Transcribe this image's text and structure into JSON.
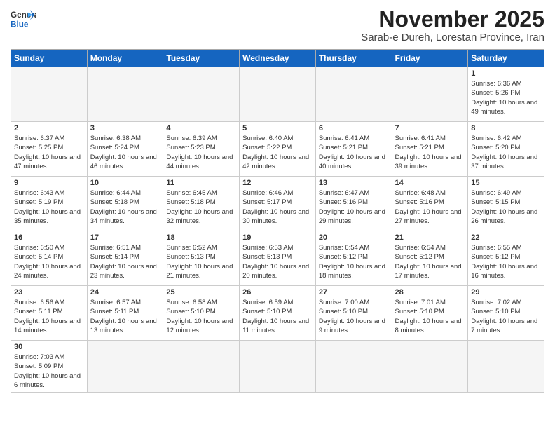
{
  "logo": {
    "general": "General",
    "blue": "Blue"
  },
  "header": {
    "month": "November 2025",
    "location": "Sarab-e Dureh, Lorestan Province, Iran"
  },
  "weekdays": [
    "Sunday",
    "Monday",
    "Tuesday",
    "Wednesday",
    "Thursday",
    "Friday",
    "Saturday"
  ],
  "weeks": [
    [
      {
        "day": "",
        "empty": true
      },
      {
        "day": "",
        "empty": true
      },
      {
        "day": "",
        "empty": true
      },
      {
        "day": "",
        "empty": true
      },
      {
        "day": "",
        "empty": true
      },
      {
        "day": "",
        "empty": true
      },
      {
        "day": "1",
        "sunrise": "6:36 AM",
        "sunset": "5:26 PM",
        "daylight": "10 hours and 49 minutes."
      }
    ],
    [
      {
        "day": "2",
        "sunrise": "6:37 AM",
        "sunset": "5:25 PM",
        "daylight": "10 hours and 47 minutes."
      },
      {
        "day": "3",
        "sunrise": "6:38 AM",
        "sunset": "5:24 PM",
        "daylight": "10 hours and 46 minutes."
      },
      {
        "day": "4",
        "sunrise": "6:39 AM",
        "sunset": "5:23 PM",
        "daylight": "10 hours and 44 minutes."
      },
      {
        "day": "5",
        "sunrise": "6:40 AM",
        "sunset": "5:22 PM",
        "daylight": "10 hours and 42 minutes."
      },
      {
        "day": "6",
        "sunrise": "6:41 AM",
        "sunset": "5:21 PM",
        "daylight": "10 hours and 40 minutes."
      },
      {
        "day": "7",
        "sunrise": "6:41 AM",
        "sunset": "5:21 PM",
        "daylight": "10 hours and 39 minutes."
      },
      {
        "day": "8",
        "sunrise": "6:42 AM",
        "sunset": "5:20 PM",
        "daylight": "10 hours and 37 minutes."
      }
    ],
    [
      {
        "day": "9",
        "sunrise": "6:43 AM",
        "sunset": "5:19 PM",
        "daylight": "10 hours and 35 minutes."
      },
      {
        "day": "10",
        "sunrise": "6:44 AM",
        "sunset": "5:18 PM",
        "daylight": "10 hours and 34 minutes."
      },
      {
        "day": "11",
        "sunrise": "6:45 AM",
        "sunset": "5:18 PM",
        "daylight": "10 hours and 32 minutes."
      },
      {
        "day": "12",
        "sunrise": "6:46 AM",
        "sunset": "5:17 PM",
        "daylight": "10 hours and 30 minutes."
      },
      {
        "day": "13",
        "sunrise": "6:47 AM",
        "sunset": "5:16 PM",
        "daylight": "10 hours and 29 minutes."
      },
      {
        "day": "14",
        "sunrise": "6:48 AM",
        "sunset": "5:16 PM",
        "daylight": "10 hours and 27 minutes."
      },
      {
        "day": "15",
        "sunrise": "6:49 AM",
        "sunset": "5:15 PM",
        "daylight": "10 hours and 26 minutes."
      }
    ],
    [
      {
        "day": "16",
        "sunrise": "6:50 AM",
        "sunset": "5:14 PM",
        "daylight": "10 hours and 24 minutes."
      },
      {
        "day": "17",
        "sunrise": "6:51 AM",
        "sunset": "5:14 PM",
        "daylight": "10 hours and 23 minutes."
      },
      {
        "day": "18",
        "sunrise": "6:52 AM",
        "sunset": "5:13 PM",
        "daylight": "10 hours and 21 minutes."
      },
      {
        "day": "19",
        "sunrise": "6:53 AM",
        "sunset": "5:13 PM",
        "daylight": "10 hours and 20 minutes."
      },
      {
        "day": "20",
        "sunrise": "6:54 AM",
        "sunset": "5:12 PM",
        "daylight": "10 hours and 18 minutes."
      },
      {
        "day": "21",
        "sunrise": "6:54 AM",
        "sunset": "5:12 PM",
        "daylight": "10 hours and 17 minutes."
      },
      {
        "day": "22",
        "sunrise": "6:55 AM",
        "sunset": "5:12 PM",
        "daylight": "10 hours and 16 minutes."
      }
    ],
    [
      {
        "day": "23",
        "sunrise": "6:56 AM",
        "sunset": "5:11 PM",
        "daylight": "10 hours and 14 minutes."
      },
      {
        "day": "24",
        "sunrise": "6:57 AM",
        "sunset": "5:11 PM",
        "daylight": "10 hours and 13 minutes."
      },
      {
        "day": "25",
        "sunrise": "6:58 AM",
        "sunset": "5:10 PM",
        "daylight": "10 hours and 12 minutes."
      },
      {
        "day": "26",
        "sunrise": "6:59 AM",
        "sunset": "5:10 PM",
        "daylight": "10 hours and 11 minutes."
      },
      {
        "day": "27",
        "sunrise": "7:00 AM",
        "sunset": "5:10 PM",
        "daylight": "10 hours and 9 minutes."
      },
      {
        "day": "28",
        "sunrise": "7:01 AM",
        "sunset": "5:10 PM",
        "daylight": "10 hours and 8 minutes."
      },
      {
        "day": "29",
        "sunrise": "7:02 AM",
        "sunset": "5:10 PM",
        "daylight": "10 hours and 7 minutes."
      }
    ],
    [
      {
        "day": "30",
        "sunrise": "7:03 AM",
        "sunset": "5:09 PM",
        "daylight": "10 hours and 6 minutes."
      },
      {
        "day": "",
        "empty": true
      },
      {
        "day": "",
        "empty": true
      },
      {
        "day": "",
        "empty": true
      },
      {
        "day": "",
        "empty": true
      },
      {
        "day": "",
        "empty": true
      },
      {
        "day": "",
        "empty": true
      }
    ]
  ],
  "labels": {
    "sunrise": "Sunrise:",
    "sunset": "Sunset:",
    "daylight": "Daylight:"
  }
}
